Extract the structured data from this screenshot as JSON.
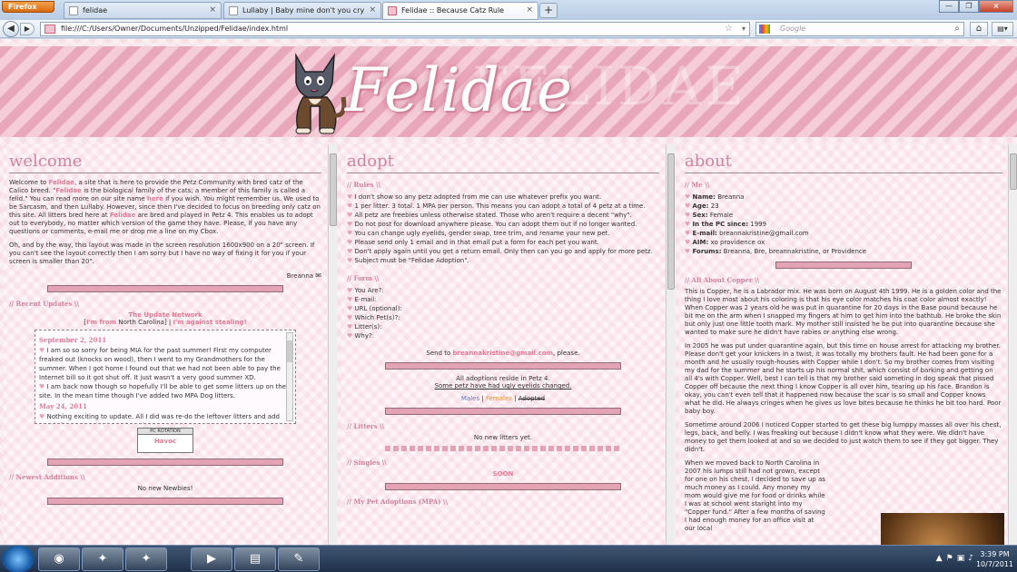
{
  "browser": {
    "app_button": "Firefox",
    "tabs": [
      {
        "label": "felidae"
      },
      {
        "label": "Lullaby | Baby mine don't you cry"
      },
      {
        "label": "Felidae :: Because Catz Rule"
      }
    ],
    "new_tab": "+",
    "url": "file:///C:/Users/Owner/Documents/Unzipped/Felidae/index.html",
    "search_placeholder": "Google"
  },
  "banner": {
    "title": "Felidae",
    "ghost": "FELIDAE"
  },
  "welcome": {
    "heading": "welcome",
    "p1_a": "Welcome to ",
    "p1_link1": "Felidae",
    "p1_b": ", a site that is here to provide the Petz Community with bred catz of the Calico breed. \"",
    "p1_link2": "Felidae",
    "p1_c": " is the biological family of the cats; a member of this family is called a felid.\" You can read more on our site name ",
    "p1_link3": "here",
    "p1_d": " if you wish. You might remember us. We used to be Sarcasm, and then Lullaby. However, since then I've decided to focus on breeding only catz on this site. All litters bred here at ",
    "p1_link4": "Felidae",
    "p1_e": " are bred and played in Petz 4. This enables us to adopt out to everybody, no matter which version of the game they have. Please, if you have any questions or comments, e-mail me or drop me a line on my Cbox.",
    "p2": "Oh, and by the way, this layout was made in the screen resolution 1600x900 on a 20\" screen. If you can't see the layout correctly then I am sorry but I have no way of fixing it for you if your screen is smaller than 20\".",
    "signature": "Breanna",
    "recent_updates": "// Recent Updates \\\\",
    "network": "The Update Network",
    "im_from": "I'm from",
    "state": "North Carolina",
    "against": "I'm against stealing!",
    "update1_date": "September 2, 2011",
    "update1_a": "I am so so sorry for being MIA for the past summer! First my computer freaked out (knocks on wood), then I went to my Grandmothers for the summer. When I got home I found out that we had not been able to pay the Internet bill so it got shut off. It just wasn't a very good summer XD.",
    "update1_b": "I am back now though so hopefully I'll be able to get some litters up on the site. In the mean time though I've added two MPA Dog litters.",
    "update2_date": "May 24, 2011",
    "update2_a": "Nothing exciting to update. All I did was re-do the leftover litters and add new leftovers so that I can breed more!",
    "pc_header": "PC ROTATION",
    "pc_name": "Havoc",
    "newest": "// Newest Additions \\\\",
    "no_newbies": "No new Newbies!"
  },
  "adopt": {
    "heading": "adopt",
    "rules_head": "// Rules \\\\",
    "rules": [
      "I don't show so any petz adopted from me can use whatever prefix you want.",
      "1 per litter. 3 total. 1 MPA per person. This means you can adopt a total of 4 petz at a time.",
      "All petz are freebies unless otherwise stated. Those who aren't require a decent \"why\".",
      "Do not post for download anywhere please. You can adopt them out if no longer wanted.",
      "You can change ugly eyelids, gender swap, tree trim, and rename your new pet.",
      "Please send only 1 email and in that email put a form for each pet you want.",
      "Don't apply again until you get a return email. Only then can you go and apply for more petz.",
      "Subject must be \"Felidae Adoption\"."
    ],
    "form_head": "// Form \\\\",
    "form": [
      "You Are?:",
      "E-mail:",
      "URL (optional):",
      "Which Pet(s)?:",
      "Litter(s):",
      "Why?:"
    ],
    "send_a": "Send to ",
    "send_email": "breannakristine@gmail.com",
    "send_b": ", please.",
    "reside": "All adoptions reside in Petz 4.",
    "eyelids": "Some petz have had ugly eyelids changed.",
    "males": "Males",
    "females": "Females",
    "adopted": "Adopted",
    "litters_head": "// Litters \\\\",
    "no_litters": "No new litters yet.",
    "singles_head": "// Singles \\\\",
    "soon": "SOON",
    "mpa_head": "// My Pet Adoptions (MPA) \\\\"
  },
  "about": {
    "heading": "about",
    "me_head": "// Me \\\\",
    "fields": [
      {
        "k": "Name:",
        "v": "Breanna"
      },
      {
        "k": "Age:",
        "v": "23"
      },
      {
        "k": "Sex:",
        "v": "Female"
      },
      {
        "k": "In the PC since:",
        "v": "1999"
      },
      {
        "k": "E-mail:",
        "v": "breannakristine@gmail.com"
      },
      {
        "k": "AIM:",
        "v": "xo providence ox"
      },
      {
        "k": "Forums:",
        "v": "Breanna, Bre, breannakristine, or Providence"
      }
    ],
    "copper_head": "// All About Copper \\\\",
    "c1": "This is Copper, he is a Labrador mix. He was born on August 4th 1999. He is a golden color and the thing I love most about his coloring is that his eye color matches his coat color almost exactly! When Copper was 2 years old he was put in quarantine for 20 days in the Base pound because he bit me on the arm when I snapped my fingers at him to get him into the bathtub. He broke the skin but only just one little tooth mark. My mother still insisted he be put into quarantine because she wanted to make sure he didn't have rabies or anything else wrong.",
    "c2": "In 2005 he was put under quarantine again, but this time on house arrest for attacking my brother. Please don't get your knickers in a twist, it was totally my brothers fault. He had been gone for a month and he usually rough-houses with Copper while I don't. So my brother comes from visiting my dad for the summer and he starts up his normal shit, which consist of barking and getting on all 4's with Copper. Well, best I can tell is that my brother said someting in dog speak that pissed Copper off because the next thing I know Copper is all over him, tearing up his face. Brandon is okay, you can't even tell that it happened now because the scar is so small and Copper knows what he did. He always cringes when he gives us love bites because he thinks he bit too hard. Poor baby boy.",
    "c3": "Sometime around 2006 I noticed Copper started to get these big lumppy masses all over his chest, legs, back, and belly. I was freaking out because I didn't know what they were. We didn't have money to get them looked at and so we decided to just watch them to see if they got bigger. They didn't.",
    "c4": "When we moved back to North Carolina in 2007 his lumps still had not grown, except for one on his chest. I decided to save up as much money as I could. Any money my mom would give me for food or drinks while I was at school went staright into my \"Copper fund.\" After a few months of saving I had enough money for an office visit at our local"
  },
  "taskbar": {
    "time": "3:39 PM",
    "date": "10/7/2011"
  },
  "colors": {
    "accent": "#e17b96",
    "heading": "#d1839b",
    "bar": "#e4a3b5"
  }
}
